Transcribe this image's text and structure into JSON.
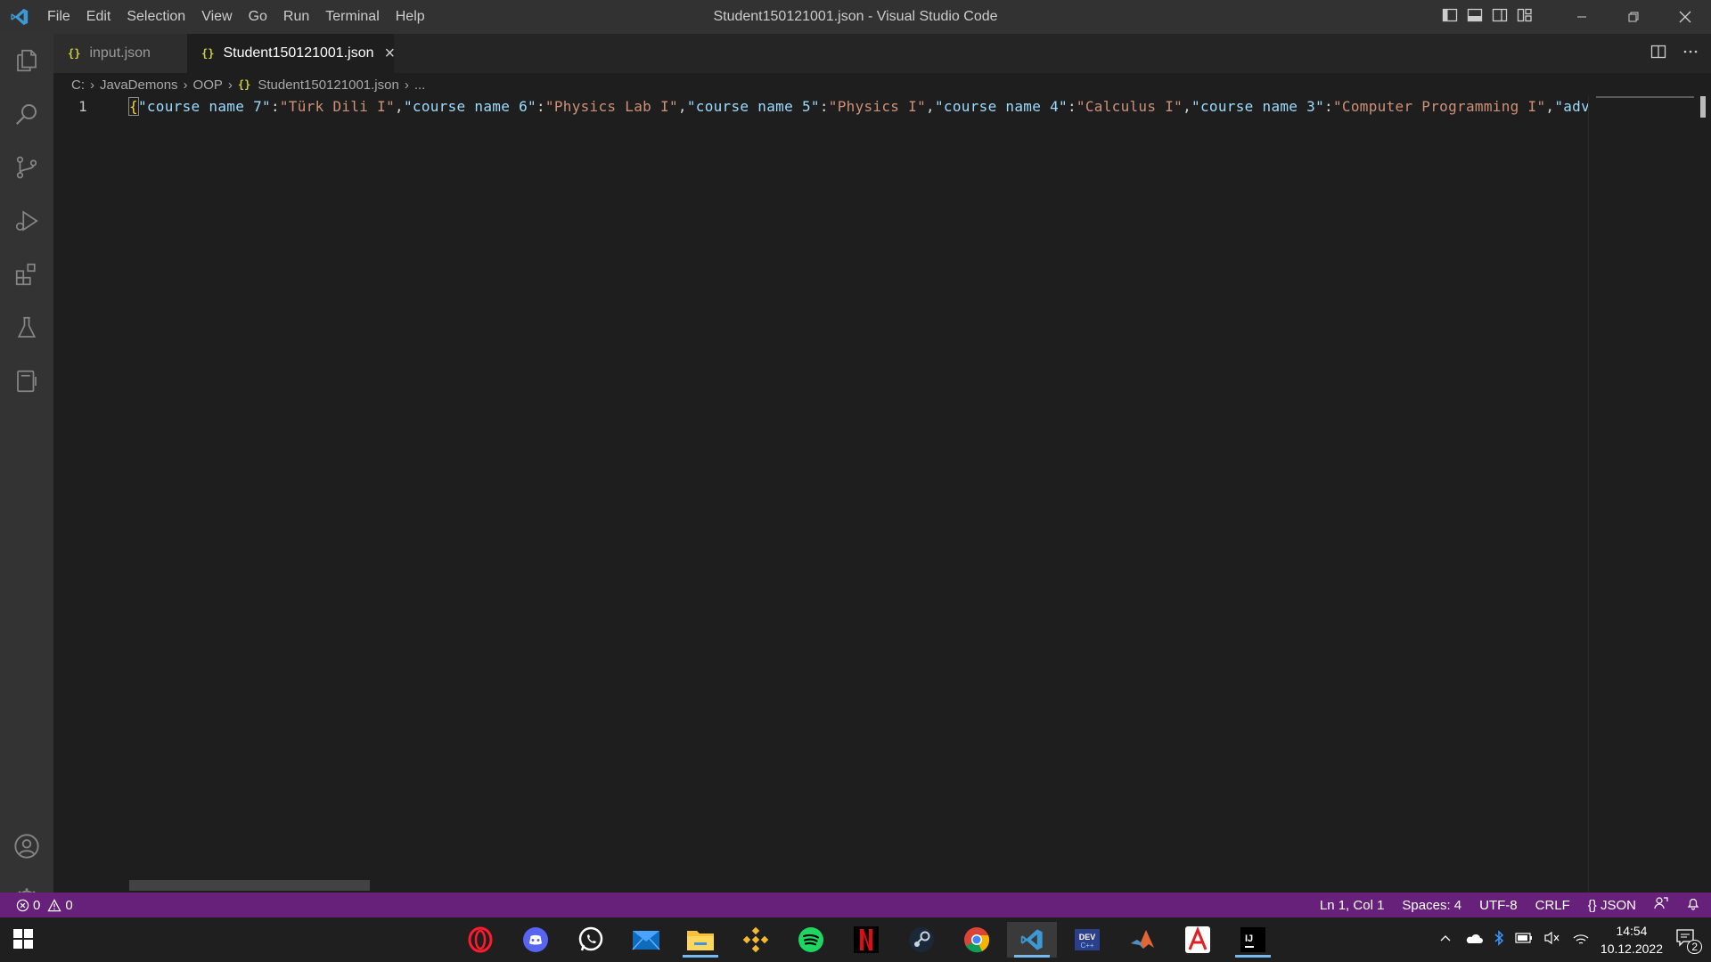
{
  "window": {
    "title": "Student150121001.json - Visual Studio Code"
  },
  "menu": [
    "File",
    "Edit",
    "Selection",
    "View",
    "Go",
    "Run",
    "Terminal",
    "Help"
  ],
  "tabs": [
    {
      "icon": "{}",
      "label": "input.json"
    },
    {
      "icon": "{}",
      "label": "Student150121001.json",
      "close": "×"
    }
  ],
  "breadcrumb": {
    "items": [
      "C:",
      "JavaDemons",
      "OOP"
    ],
    "file": "Student150121001.json",
    "file_icon": "{}",
    "more": "..."
  },
  "editor": {
    "line_number": "1",
    "pairs": [
      {
        "key": "\"course name 7\"",
        "value": "\"Türk Dili I\""
      },
      {
        "key": "\"course name 6\"",
        "value": "\"Physics Lab I\""
      },
      {
        "key": "\"course name 5\"",
        "value": "\"Physics I\""
      },
      {
        "key": "\"course name 4\"",
        "value": "\"Calculus I\""
      },
      {
        "key": "\"course name 3\"",
        "value": "\"Computer Programming I\""
      }
    ],
    "tail": "\"advisor"
  },
  "status": {
    "errors": "0",
    "warnings": "0",
    "position": "Ln 1, Col 1",
    "spaces": "Spaces: 4",
    "encoding": "UTF-8",
    "eol": "CRLF",
    "language": "{} JSON"
  },
  "taskbar": {
    "time": "14:54",
    "date": "10.12.2022",
    "notifications": "2"
  },
  "colors": {
    "statusbar": "#68217a",
    "json_key": "#9cdcfe",
    "json_string": "#ce9178",
    "json_icon": "#cbcb41"
  }
}
